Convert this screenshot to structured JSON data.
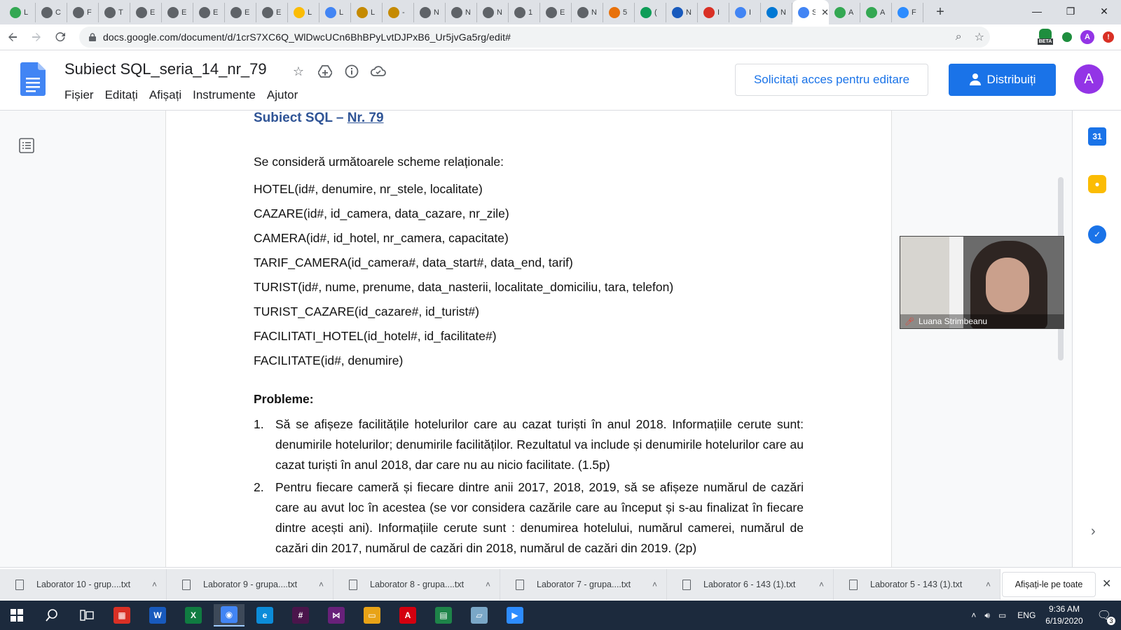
{
  "browser": {
    "tabs": [
      {
        "letter": "L",
        "color": "#34a853",
        "icon": "drive-icon"
      },
      {
        "letter": "C",
        "color": "#5f6368",
        "icon": "github-icon"
      },
      {
        "letter": "F",
        "color": "#5f6368",
        "icon": "github-icon"
      },
      {
        "letter": "T",
        "color": "#5f6368",
        "icon": "github-icon"
      },
      {
        "letter": "E",
        "color": "#5f6368",
        "icon": "github-icon"
      },
      {
        "letter": "E",
        "color": "#5f6368",
        "icon": "github-icon"
      },
      {
        "letter": "E",
        "color": "#5f6368",
        "icon": "github-icon"
      },
      {
        "letter": "E",
        "color": "#5f6368",
        "icon": "github-icon"
      },
      {
        "letter": "E",
        "color": "#5f6368",
        "icon": "github-icon"
      },
      {
        "letter": "L",
        "color": "#fbbc04",
        "icon": "drive-icon"
      },
      {
        "letter": "L",
        "color": "#4285f4",
        "icon": "docs-icon"
      },
      {
        "letter": "L",
        "color": "#c58a00",
        "icon": "moodle-icon"
      },
      {
        "letter": "-",
        "color": "#c58a00",
        "icon": "moodle-icon"
      },
      {
        "letter": "N",
        "color": "#5f6368",
        "icon": "github-icon"
      },
      {
        "letter": "N",
        "color": "#5f6368",
        "icon": "github-icon"
      },
      {
        "letter": "N",
        "color": "#5f6368",
        "icon": "github-icon"
      },
      {
        "letter": "1",
        "color": "#5f6368",
        "icon": "github-icon"
      },
      {
        "letter": "E",
        "color": "#5f6368",
        "icon": "github-icon"
      },
      {
        "letter": "N",
        "color": "#5f6368",
        "icon": "github-icon"
      },
      {
        "letter": "5",
        "color": "#e8710a",
        "icon": "site-icon"
      },
      {
        "letter": "(",
        "color": "#0f9d58",
        "icon": "site-icon"
      },
      {
        "letter": "N",
        "color": "#185abd",
        "icon": "teams-icon"
      },
      {
        "letter": "I",
        "color": "#d93025",
        "icon": "gmail-icon"
      },
      {
        "letter": "I",
        "color": "#4285f4",
        "icon": "docs-icon"
      },
      {
        "letter": "N",
        "color": "#0078d4",
        "icon": "outlook-icon"
      }
    ],
    "active_tab": {
      "letter": "Su",
      "close": "✕"
    },
    "trailing_tabs": [
      {
        "letter": "A",
        "color": "#34a853",
        "icon": "drive-icon"
      },
      {
        "letter": "A",
        "color": "#34a853",
        "icon": "drive-icon"
      },
      {
        "letter": "F",
        "color": "#2d8cff",
        "icon": "zoom-icon"
      }
    ],
    "new_tab": "+",
    "window_controls": {
      "minimize": "—",
      "restore": "❐",
      "close": "✕"
    },
    "url": "docs.google.com/document/d/1crS7XC6Q_WlDwcUCn6BhBPyLvtDJPxB6_Ur5jvGa5rg/edit#",
    "ext_beta": "BETA",
    "profile_letter": "A"
  },
  "docs": {
    "title": "Subiect SQL_seria_14_nr_79",
    "menu": [
      "Fișier",
      "Editați",
      "Afișați",
      "Instrumente",
      "Ajutor"
    ],
    "request_access": "Solicitați acces pentru editare",
    "share": "Distribuiți",
    "avatar": "A"
  },
  "document": {
    "heading_prefix": "Subiect SQL – ",
    "heading_link": "Nr. 79",
    "intro": "Se consideră următoarele scheme relaționale:",
    "schemas": [
      "HOTEL(id#, denumire, nr_stele, localitate)",
      "CAZARE(id#, id_camera, data_cazare, nr_zile)",
      "CAMERA(id#, id_hotel, nr_camera, capacitate)",
      "TARIF_CAMERA(id_camera#, data_start#, data_end, tarif)",
      "TURIST(id#, nume, prenume, data_nasterii, localitate_domiciliu, tara, telefon)",
      "TURIST_CAZARE(id_cazare#, id_turist#)",
      "FACILITATI_HOTEL(id_hotel#, id_facilitate#)",
      "FACILITATE(id#, denumire)"
    ],
    "problems_title": "Probleme:",
    "problems": [
      {
        "num": "1.",
        "text": "Să se afișeze facilitățile hotelurilor care au cazat turiști în anul 2018. Informațiile cerute sunt: denumirile hotelurilor; denumirile facilităților. Rezultatul va include și denumirile hotelurilor care au cazat turiști în anul 2018, dar care nu au nicio facilitate. (1.5p)"
      },
      {
        "num": "2.",
        "text": "Pentru fiecare cameră și fiecare dintre anii 2017, 2018, 2019, să se afișeze numărul de cazări care au avut loc în acestea (se vor considera cazările care au început și s-au finalizat în fiecare dintre acești ani). Informațiile cerute sunt : denumirea hotelului, numărul camerei, numărul de cazări din 2017, numărul de cazări din 2018, numărul de cazări din 2019. (2p)"
      }
    ]
  },
  "video": {
    "participant": "Luana Strimbeanu"
  },
  "side_panel": {
    "calendar": "31"
  },
  "downloads": {
    "files": [
      "Laborator 10 - grup....txt",
      "Laborator 9 - grupa....txt",
      "Laborator 8 - grupa....txt",
      "Laborator 7 - grupa....txt",
      "Laborator 6 - 143 (1).txt",
      "Laborator 5 - 143 (1).txt"
    ],
    "show_all": "Afișați-le pe toate",
    "close": "✕"
  },
  "taskbar": {
    "language": "ENG",
    "time": "9:36 AM",
    "date": "6/19/2020",
    "notifications": "3",
    "apps": [
      {
        "name": "gift-icon",
        "color": "#d93025",
        "label": "▦"
      },
      {
        "name": "word-icon",
        "color": "#185abd",
        "label": "W"
      },
      {
        "name": "excel-icon",
        "color": "#107c41",
        "label": "X"
      },
      {
        "name": "chrome-icon",
        "color": "#4285f4",
        "label": "◉"
      },
      {
        "name": "edge-icon",
        "color": "#0c8cd9",
        "label": "e"
      },
      {
        "name": "slack-icon",
        "color": "#4a154b",
        "label": "#"
      },
      {
        "name": "visual-studio-icon",
        "color": "#68217a",
        "label": "⋈"
      },
      {
        "name": "file-explorer-icon",
        "color": "#e8a317",
        "label": "▭"
      },
      {
        "name": "acrobat-icon",
        "color": "#d4000f",
        "label": "A"
      },
      {
        "name": "app-icon",
        "color": "#1e8449",
        "label": "▤"
      },
      {
        "name": "notepad-icon",
        "color": "#7aa7c7",
        "label": "▱"
      },
      {
        "name": "zoom-icon",
        "color": "#2d8cff",
        "label": "▶"
      }
    ]
  }
}
